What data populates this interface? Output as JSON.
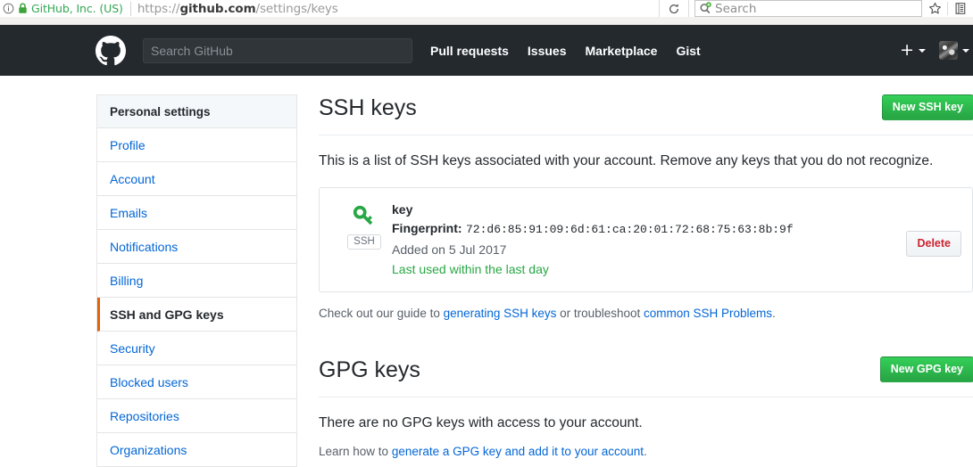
{
  "browser": {
    "identity_label": "GitHub, Inc. (US)",
    "url_prefix": "https://",
    "url_domain": "github.com",
    "url_path": "/settings/keys",
    "search_placeholder": "Search",
    "icons": {
      "info": "info-circle-icon",
      "lock": "padlock-icon",
      "reload": "reload-icon",
      "search_engine": "search-add-icon",
      "bookmark": "star-icon",
      "library": "library-icon"
    }
  },
  "gh_header": {
    "logo": "github-octocat-logo",
    "search_placeholder": "Search GitHub",
    "nav": [
      {
        "label": "Pull requests"
      },
      {
        "label": "Issues"
      },
      {
        "label": "Marketplace"
      },
      {
        "label": "Gist"
      }
    ],
    "create_new": "+",
    "avatar": "user-avatar"
  },
  "sidebar": {
    "header": "Personal settings",
    "items": [
      {
        "label": "Profile",
        "active": false
      },
      {
        "label": "Account",
        "active": false
      },
      {
        "label": "Emails",
        "active": false
      },
      {
        "label": "Notifications",
        "active": false
      },
      {
        "label": "Billing",
        "active": false
      },
      {
        "label": "SSH and GPG keys",
        "active": true
      },
      {
        "label": "Security",
        "active": false
      },
      {
        "label": "Blocked users",
        "active": false
      },
      {
        "label": "Repositories",
        "active": false
      },
      {
        "label": "Organizations",
        "active": false
      }
    ]
  },
  "ssh_section": {
    "title": "SSH keys",
    "new_button": "New SSH key",
    "intro": "This is a list of SSH keys associated with your account. Remove any keys that you do not recognize.",
    "key": {
      "name": "key",
      "fingerprint_label": "Fingerprint:",
      "fingerprint_value": "72:d6:85:91:09:6d:61:ca:20:01:72:68:75:63:8b:9f",
      "added": "Added on 5 Jul 2017",
      "last_used": "Last used within the last day",
      "badge": "SSH",
      "icon": "key-icon",
      "delete_button": "Delete"
    },
    "guide": {
      "prefix": "Check out our guide to ",
      "link1": "generating SSH keys",
      "middle": " or troubleshoot ",
      "link2": "common SSH Problems",
      "suffix": "."
    }
  },
  "gpg_section": {
    "title": "GPG keys",
    "new_button": "New GPG key",
    "empty_text": "There are no GPG keys with access to your account.",
    "learn": {
      "prefix": "Learn how to ",
      "link": "generate a GPG key and add it to your account",
      "suffix": "."
    }
  },
  "colors": {
    "github_header_bg": "#24292e",
    "link_blue": "#0366d6",
    "green_button": "#28a745",
    "active_orange": "#e36209",
    "delete_red": "#cb2431",
    "identity_green": "#34a853"
  }
}
